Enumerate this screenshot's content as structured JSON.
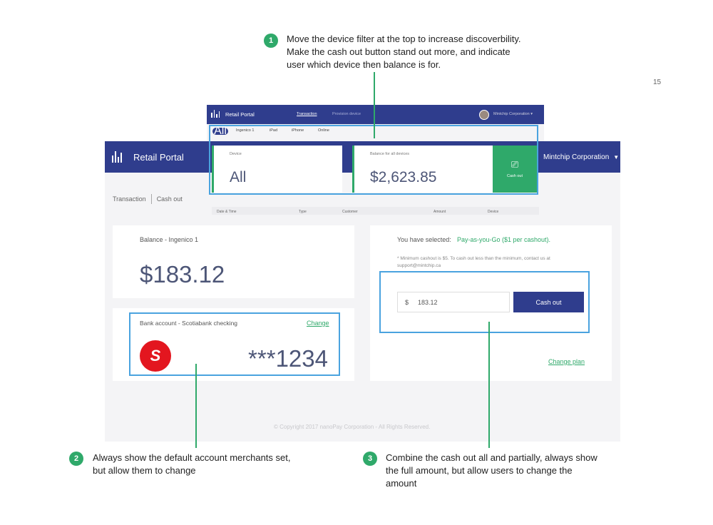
{
  "annotations": {
    "note1": {
      "number": "1",
      "lines": [
        "Move the device filter at the top to increase discoverbility.",
        "Make the cash out button stand out more, and indicate",
        "user which device then balance is for."
      ]
    },
    "note2": {
      "number": "2",
      "lines": [
        "Always show the default account merchants set,",
        "but allow them to change"
      ]
    },
    "note3": {
      "number": "3",
      "lines": [
        "Combine the cash out all and partially, always show",
        "the full amount, but allow users to change the",
        "amount"
      ]
    },
    "page_number": "15"
  },
  "top_mockup": {
    "app_title": "Retail Portal",
    "tabs": [
      "Transaction",
      "Provision device"
    ],
    "user": "Mintchip Corporation ▾",
    "device_filters": [
      "All",
      "Ingenico 1",
      "iPad",
      "iPhone",
      "Online"
    ],
    "device_card": {
      "label": "Device",
      "value": "All"
    },
    "balance_card": {
      "label": "Balance for all devices",
      "value": "$2,623.85"
    },
    "cash_out_button": {
      "icon": "cash-register-icon",
      "label": "Cash out"
    },
    "table_headers": [
      "Date & Time",
      "Type",
      "Customer",
      "Amount",
      "Device"
    ]
  },
  "portal": {
    "app_title": "Retail Portal",
    "user": "Mintchip Corporation",
    "nav": [
      "Transaction",
      "Cash out"
    ],
    "balance": {
      "label": "Balance - Ingenico 1",
      "amount": "$183.12"
    },
    "bank": {
      "label": "Bank account - Scotiabank checking",
      "change": "Change",
      "logo": "S",
      "number": "***1234"
    },
    "plan": {
      "label": "You have selected:",
      "value": "Pay-as-you-Go ($1 per cashout)."
    },
    "min_note": "* Minimum cashout is $5. To cash out less than the minimum, contact us at support@mintchip.ca",
    "amount_input": {
      "currency": "$",
      "value": "183.12"
    },
    "cash_out_button": "Cash out",
    "change_plan": "Change plan",
    "copyright": "© Copyright 2017 nanoPay Corporation - All Rights Reserved."
  },
  "colors": {
    "brand": "#2f3d8d",
    "accent": "#2fa96a",
    "highlight": "#4aa3df",
    "scotiabank": "#e3161f"
  }
}
